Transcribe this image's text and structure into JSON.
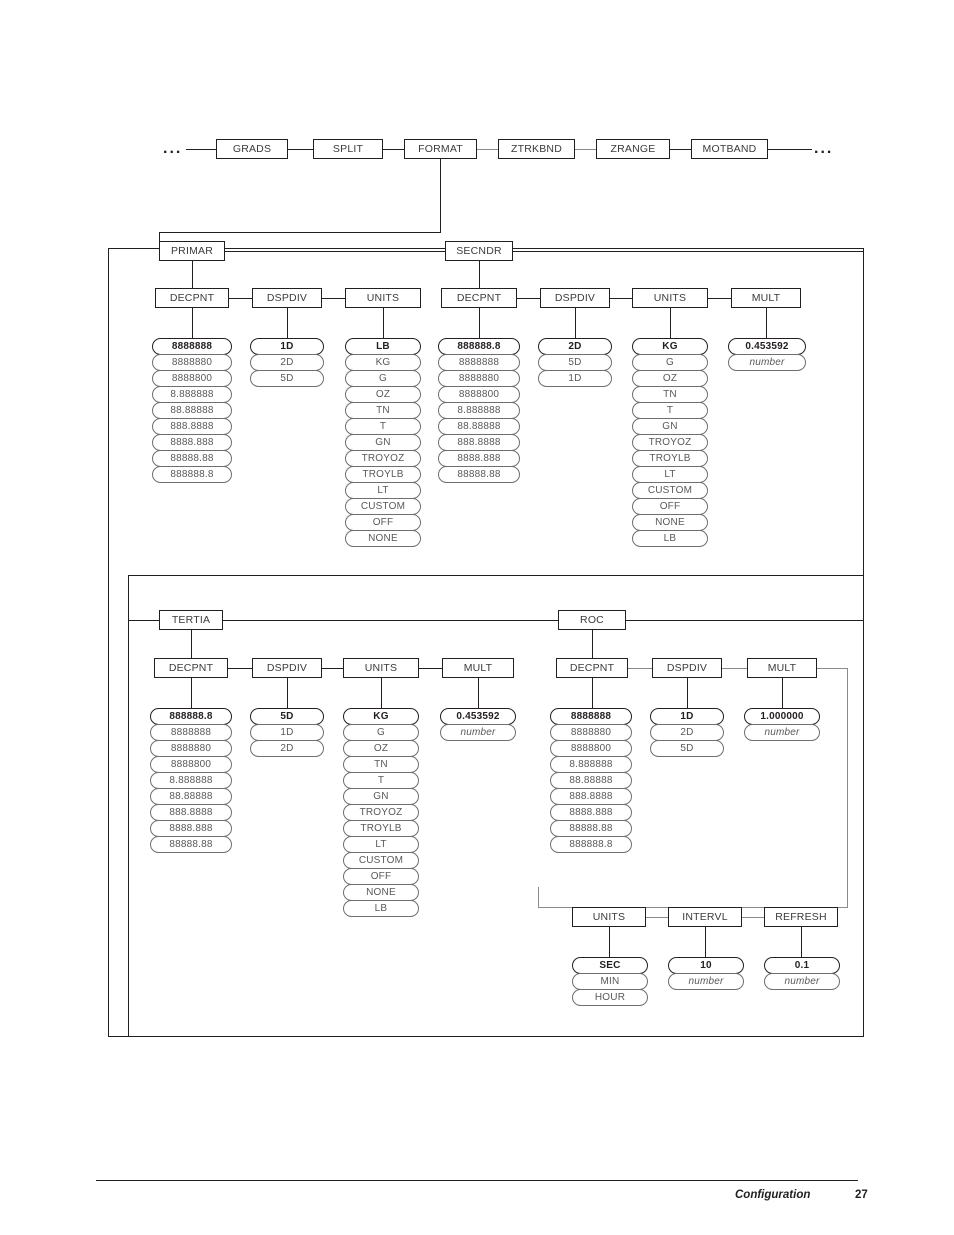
{
  "page": {
    "footer_label": "Configuration",
    "footer_page": "27",
    "ellipsis_left": "...",
    "ellipsis_right": "..."
  },
  "top_menu": {
    "items": [
      {
        "label": "GRADS"
      },
      {
        "label": "SPLIT"
      },
      {
        "label": "FORMAT"
      },
      {
        "label": "ZTRKBND"
      },
      {
        "label": "ZRANGE"
      },
      {
        "label": "MOTBAND"
      }
    ]
  },
  "groups": {
    "primar": {
      "label": "PRIMAR",
      "params": [
        {
          "label": "DECPNT",
          "values": [
            "8888888",
            "8888880",
            "8888800",
            "8.888888",
            "88.88888",
            "888.8888",
            "8888.888",
            "88888.88",
            "888888.8"
          ]
        },
        {
          "label": "DSPDIV",
          "values": [
            "1D",
            "2D",
            "5D"
          ]
        },
        {
          "label": "UNITS",
          "values": [
            "LB",
            "KG",
            "G",
            "OZ",
            "TN",
            "T",
            "GN",
            "TROYOZ",
            "TROYLB",
            "LT",
            "CUSTOM",
            "OFF",
            "NONE"
          ]
        }
      ]
    },
    "secndr": {
      "label": "SECNDR",
      "params": [
        {
          "label": "DECPNT",
          "values": [
            "888888.8",
            "8888888",
            "8888880",
            "8888800",
            "8.888888",
            "88.88888",
            "888.8888",
            "8888.888",
            "88888.88"
          ]
        },
        {
          "label": "DSPDIV",
          "values": [
            "2D",
            "5D",
            "1D"
          ]
        },
        {
          "label": "UNITS",
          "values": [
            "KG",
            "G",
            "OZ",
            "TN",
            "T",
            "GN",
            "TROYOZ",
            "TROYLB",
            "LT",
            "CUSTOM",
            "OFF",
            "NONE",
            "LB"
          ]
        },
        {
          "label": "MULT",
          "values": [
            "0.453592",
            "number"
          ]
        }
      ]
    },
    "tertia": {
      "label": "TERTIA",
      "params": [
        {
          "label": "DECPNT",
          "values": [
            "888888.8",
            "8888888",
            "8888880",
            "8888800",
            "8.888888",
            "88.88888",
            "888.8888",
            "8888.888",
            "88888.88"
          ]
        },
        {
          "label": "DSPDIV",
          "values": [
            "5D",
            "1D",
            "2D"
          ]
        },
        {
          "label": "UNITS",
          "values": [
            "KG",
            "G",
            "OZ",
            "TN",
            "T",
            "GN",
            "TROYOZ",
            "TROYLB",
            "LT",
            "CUSTOM",
            "OFF",
            "NONE",
            "LB"
          ]
        },
        {
          "label": "MULT",
          "values": [
            "0.453592",
            "number"
          ]
        }
      ]
    },
    "roc": {
      "label": "ROC",
      "params": [
        {
          "label": "DECPNT",
          "values": [
            "8888888",
            "8888880",
            "8888800",
            "8.888888",
            "88.88888",
            "888.8888",
            "8888.888",
            "88888.88",
            "888888.8"
          ]
        },
        {
          "label": "DSPDIV",
          "values": [
            "1D",
            "2D",
            "5D"
          ]
        },
        {
          "label": "MULT",
          "values": [
            "1.000000",
            "number"
          ]
        },
        {
          "label": "UNITS",
          "values": [
            "SEC",
            "MIN",
            "HOUR"
          ]
        },
        {
          "label": "INTERVL",
          "values": [
            "10",
            "number"
          ]
        },
        {
          "label": "REFRESH",
          "values": [
            "0.1",
            "number"
          ]
        }
      ]
    }
  }
}
